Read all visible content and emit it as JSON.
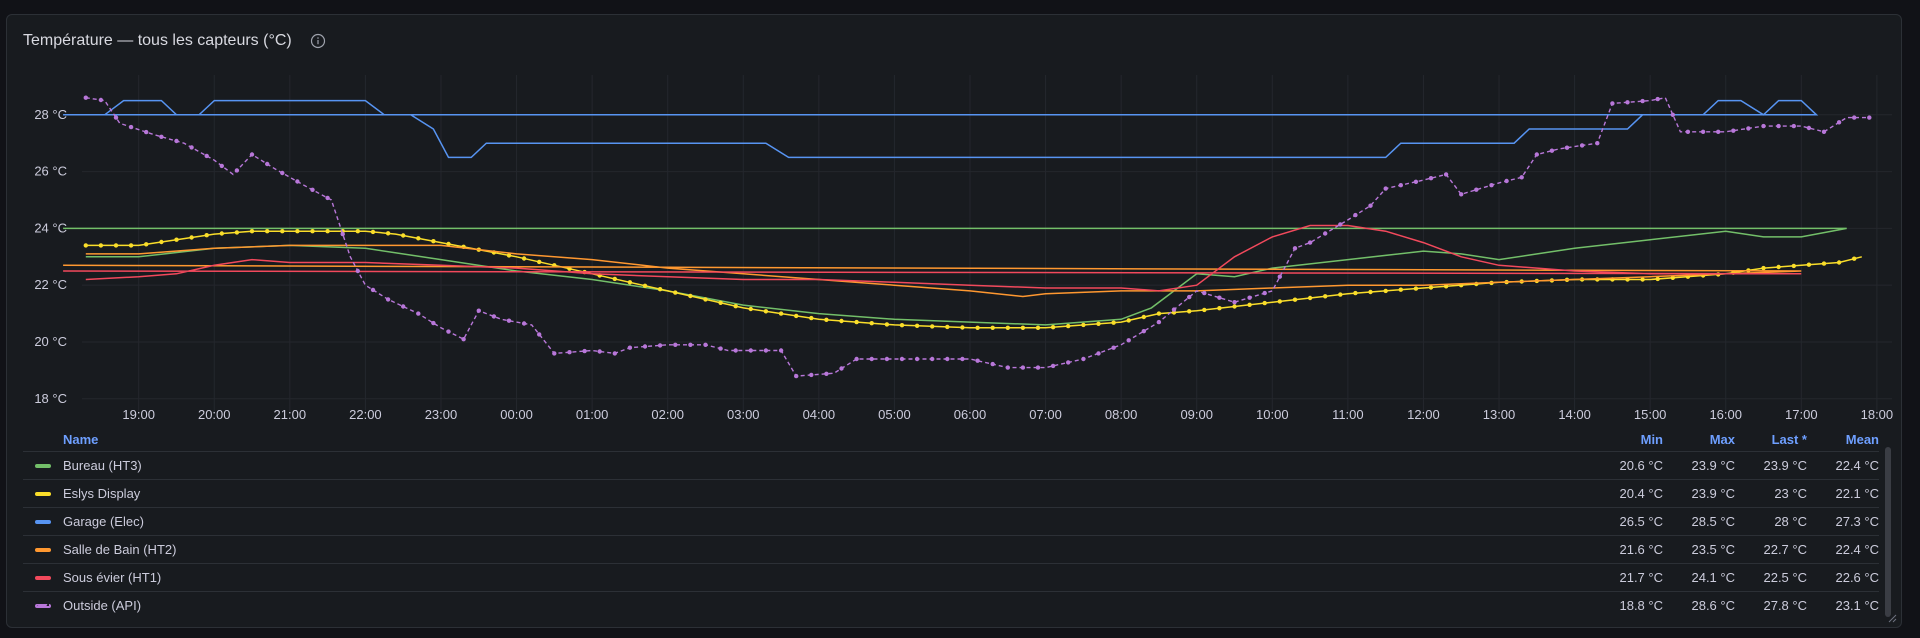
{
  "panel": {
    "title": "Température — tous les capteurs (°C)",
    "info_icon": "info-circle-icon"
  },
  "legend": {
    "headers": {
      "name": "Name",
      "min": "Min",
      "max": "Max",
      "last": "Last *",
      "mean": "Mean"
    },
    "rows": [
      {
        "name": "Bureau (HT3)",
        "min": "20.6 °C",
        "max": "23.9 °C",
        "last": "23.9 °C",
        "mean": "22.4 °C",
        "color": "#73bf69",
        "dashed": false
      },
      {
        "name": "Eslys Display",
        "min": "20.4 °C",
        "max": "23.9 °C",
        "last": "23 °C",
        "mean": "22.1 °C",
        "color": "#fade2a",
        "dashed": false
      },
      {
        "name": "Garage (Elec)",
        "min": "26.5 °C",
        "max": "28.5 °C",
        "last": "28 °C",
        "mean": "27.3 °C",
        "color": "#5794f2",
        "dashed": false
      },
      {
        "name": "Salle de Bain (HT2)",
        "min": "21.6 °C",
        "max": "23.5 °C",
        "last": "22.7 °C",
        "mean": "22.4 °C",
        "color": "#ff9830",
        "dashed": false
      },
      {
        "name": "Sous évier (HT1)",
        "min": "21.7 °C",
        "max": "24.1 °C",
        "last": "22.5 °C",
        "mean": "22.6 °C",
        "color": "#f2495c",
        "dashed": false
      },
      {
        "name": "Outside (API)",
        "min": "18.8 °C",
        "max": "28.6 °C",
        "last": "27.8 °C",
        "mean": "23.1 °C",
        "color": "#b877d9",
        "dashed": true
      }
    ]
  },
  "chart_data": {
    "type": "line",
    "xlabel": "",
    "ylabel": "",
    "x_unit": "hours (labels show HH:00)",
    "xlim": [
      18.25,
      42.2
    ],
    "ylim": [
      17.5,
      29.4
    ],
    "x_ticks": [
      "19:00",
      "20:00",
      "21:00",
      "22:00",
      "23:00",
      "00:00",
      "01:00",
      "02:00",
      "03:00",
      "04:00",
      "05:00",
      "06:00",
      "07:00",
      "08:00",
      "09:00",
      "10:00",
      "11:00",
      "12:00",
      "13:00",
      "14:00",
      "15:00",
      "16:00",
      "17:00",
      "18:00"
    ],
    "y_ticks": [
      "18 °C",
      "20 °C",
      "22 °C",
      "24 °C",
      "26 °C",
      "28 °C"
    ],
    "y_tick_values": [
      18,
      20,
      22,
      24,
      26,
      28
    ],
    "grid": true,
    "legend": "bottom",
    "series": [
      {
        "name": "Bureau (HT3)",
        "color": "#73bf69",
        "dashed": false,
        "points": [
          [
            18.3,
            23.0
          ],
          [
            19.0,
            23.0
          ],
          [
            20.0,
            23.3
          ],
          [
            21.0,
            23.4
          ],
          [
            22.0,
            23.3
          ],
          [
            23.0,
            22.9
          ],
          [
            0.0,
            22.5
          ],
          [
            1.0,
            22.2
          ],
          [
            2.0,
            21.8
          ],
          [
            3.0,
            21.3
          ],
          [
            4.0,
            21.0
          ],
          [
            5.0,
            20.8
          ],
          [
            6.0,
            20.7
          ],
          [
            7.0,
            20.6
          ],
          [
            8.0,
            20.8
          ],
          [
            8.4,
            21.2
          ],
          [
            9.0,
            22.4
          ],
          [
            9.5,
            22.3
          ],
          [
            10.0,
            22.6
          ],
          [
            11.0,
            22.9
          ],
          [
            12.0,
            23.2
          ],
          [
            12.5,
            23.1
          ],
          [
            13.0,
            22.9
          ],
          [
            14.0,
            23.3
          ],
          [
            15.0,
            23.6
          ],
          [
            16.0,
            23.9
          ],
          [
            16.5,
            23.7
          ],
          [
            17.0,
            23.7
          ],
          [
            17.6,
            24.0
          ],
          [
            18.0,
            24.0
          ]
        ]
      },
      {
        "name": "Eslys Display",
        "color": "#fade2a",
        "dashed": false,
        "points": [
          [
            18.3,
            23.4
          ],
          [
            19.0,
            23.4
          ],
          [
            20.0,
            23.8
          ],
          [
            20.5,
            23.9
          ],
          [
            21.0,
            23.9
          ],
          [
            22.0,
            23.9
          ],
          [
            22.4,
            23.8
          ],
          [
            23.0,
            23.5
          ],
          [
            0.0,
            23.0
          ],
          [
            1.0,
            22.4
          ],
          [
            2.0,
            21.8
          ],
          [
            3.0,
            21.2
          ],
          [
            4.0,
            20.8
          ],
          [
            5.0,
            20.6
          ],
          [
            6.0,
            20.5
          ],
          [
            7.0,
            20.5
          ],
          [
            8.0,
            20.7
          ],
          [
            8.5,
            21.0
          ],
          [
            9.0,
            21.1
          ],
          [
            10.0,
            21.4
          ],
          [
            11.0,
            21.7
          ],
          [
            12.0,
            21.9
          ],
          [
            13.0,
            22.1
          ],
          [
            14.0,
            22.2
          ],
          [
            15.0,
            22.2
          ],
          [
            16.0,
            22.4
          ],
          [
            16.5,
            22.6
          ],
          [
            17.0,
            22.7
          ],
          [
            17.5,
            22.8
          ],
          [
            17.8,
            23.0
          ]
        ]
      },
      {
        "name": "Garage (Elec)",
        "color": "#5794f2",
        "dashed": false,
        "points": [
          [
            18.3,
            28.0
          ],
          [
            18.55,
            28.0
          ],
          [
            18.8,
            28.5
          ],
          [
            19.3,
            28.5
          ],
          [
            19.5,
            28.0
          ],
          [
            19.8,
            28.0
          ],
          [
            20.0,
            28.5
          ],
          [
            22.0,
            28.5
          ],
          [
            22.25,
            28.0
          ],
          [
            22.6,
            28.0
          ],
          [
            22.9,
            27.5
          ],
          [
            23.1,
            26.5
          ],
          [
            23.4,
            26.5
          ],
          [
            23.6,
            27.0
          ],
          [
            3.3,
            27.0
          ],
          [
            3.6,
            26.5
          ],
          [
            11.5,
            26.5
          ],
          [
            11.7,
            27.0
          ],
          [
            13.2,
            27.0
          ],
          [
            13.4,
            27.5
          ],
          [
            14.7,
            27.5
          ],
          [
            14.9,
            28.0
          ],
          [
            15.7,
            28.0
          ],
          [
            15.9,
            28.5
          ],
          [
            16.2,
            28.5
          ],
          [
            16.5,
            28.0
          ],
          [
            16.7,
            28.5
          ],
          [
            17.0,
            28.5
          ],
          [
            17.2,
            28.0
          ],
          [
            18.0,
            28.0
          ]
        ]
      },
      {
        "name": "Salle de Bain (HT2)",
        "color": "#ff9830",
        "dashed": false,
        "points": [
          [
            18.3,
            23.1
          ],
          [
            19.0,
            23.1
          ],
          [
            20.0,
            23.3
          ],
          [
            21.0,
            23.4
          ],
          [
            22.0,
            23.4
          ],
          [
            23.0,
            23.4
          ],
          [
            0.0,
            23.1
          ],
          [
            1.0,
            22.9
          ],
          [
            2.0,
            22.6
          ],
          [
            3.0,
            22.4
          ],
          [
            4.0,
            22.2
          ],
          [
            5.0,
            22.0
          ],
          [
            6.0,
            21.8
          ],
          [
            6.7,
            21.6
          ],
          [
            7.0,
            21.7
          ],
          [
            8.0,
            21.8
          ],
          [
            9.0,
            21.8
          ],
          [
            10.0,
            21.9
          ],
          [
            11.0,
            22.0
          ],
          [
            12.0,
            22.0
          ],
          [
            13.0,
            22.1
          ],
          [
            14.0,
            22.2
          ],
          [
            15.0,
            22.3
          ],
          [
            16.0,
            22.4
          ],
          [
            17.0,
            22.5
          ],
          [
            18.0,
            22.7
          ]
        ]
      },
      {
        "name": "Sous évier (HT1)",
        "color": "#f2495c",
        "dashed": false,
        "points": [
          [
            18.3,
            22.2
          ],
          [
            19.0,
            22.3
          ],
          [
            19.5,
            22.4
          ],
          [
            20.0,
            22.7
          ],
          [
            20.5,
            22.9
          ],
          [
            21.0,
            22.8
          ],
          [
            22.0,
            22.8
          ],
          [
            23.0,
            22.7
          ],
          [
            0.0,
            22.6
          ],
          [
            1.0,
            22.4
          ],
          [
            2.0,
            22.3
          ],
          [
            3.0,
            22.2
          ],
          [
            4.0,
            22.2
          ],
          [
            5.0,
            22.1
          ],
          [
            6.0,
            22.0
          ],
          [
            7.0,
            21.9
          ],
          [
            8.0,
            21.9
          ],
          [
            8.5,
            21.8
          ],
          [
            9.0,
            22.0
          ],
          [
            9.5,
            23.0
          ],
          [
            10.0,
            23.7
          ],
          [
            10.5,
            24.1
          ],
          [
            11.0,
            24.1
          ],
          [
            11.5,
            23.9
          ],
          [
            12.0,
            23.5
          ],
          [
            12.5,
            23.0
          ],
          [
            13.0,
            22.7
          ],
          [
            14.0,
            22.5
          ],
          [
            15.0,
            22.4
          ],
          [
            16.0,
            22.4
          ],
          [
            17.0,
            22.4
          ],
          [
            18.0,
            22.5
          ]
        ]
      },
      {
        "name": "Outside (API)",
        "color": "#b877d9",
        "dashed": true,
        "points": [
          [
            18.3,
            28.6
          ],
          [
            18.55,
            28.5
          ],
          [
            18.75,
            27.7
          ],
          [
            19.2,
            27.3
          ],
          [
            19.6,
            27.0
          ],
          [
            20.0,
            26.4
          ],
          [
            20.25,
            25.9
          ],
          [
            20.5,
            26.6
          ],
          [
            20.8,
            26.1
          ],
          [
            21.2,
            25.5
          ],
          [
            21.55,
            25.0
          ],
          [
            21.8,
            23.0
          ],
          [
            22.0,
            22.0
          ],
          [
            22.3,
            21.5
          ],
          [
            22.7,
            21.0
          ],
          [
            23.0,
            20.5
          ],
          [
            23.3,
            20.1
          ],
          [
            23.5,
            21.1
          ],
          [
            23.8,
            20.8
          ],
          [
            0.2,
            20.6
          ],
          [
            0.5,
            19.6
          ],
          [
            1.0,
            19.7
          ],
          [
            1.3,
            19.6
          ],
          [
            1.5,
            19.8
          ],
          [
            2.0,
            19.9
          ],
          [
            2.5,
            19.9
          ],
          [
            2.8,
            19.7
          ],
          [
            3.5,
            19.7
          ],
          [
            3.7,
            18.8
          ],
          [
            4.2,
            18.9
          ],
          [
            4.5,
            19.4
          ],
          [
            5.0,
            19.4
          ],
          [
            6.0,
            19.4
          ],
          [
            6.5,
            19.1
          ],
          [
            7.0,
            19.1
          ],
          [
            7.5,
            19.4
          ],
          [
            8.0,
            19.9
          ],
          [
            8.5,
            20.7
          ],
          [
            9.0,
            21.8
          ],
          [
            9.5,
            21.4
          ],
          [
            10.0,
            21.8
          ],
          [
            10.3,
            23.3
          ],
          [
            10.5,
            23.5
          ],
          [
            11.0,
            24.3
          ],
          [
            11.3,
            24.8
          ],
          [
            11.5,
            25.4
          ],
          [
            12.0,
            25.7
          ],
          [
            12.3,
            25.9
          ],
          [
            12.5,
            25.2
          ],
          [
            13.0,
            25.6
          ],
          [
            13.3,
            25.8
          ],
          [
            13.5,
            26.6
          ],
          [
            13.8,
            26.8
          ],
          [
            14.3,
            27.0
          ],
          [
            14.5,
            28.4
          ],
          [
            15.0,
            28.5
          ],
          [
            15.2,
            28.6
          ],
          [
            15.4,
            27.4
          ],
          [
            16.0,
            27.4
          ],
          [
            16.5,
            27.6
          ],
          [
            17.0,
            27.6
          ],
          [
            17.3,
            27.4
          ],
          [
            17.6,
            27.9
          ],
          [
            17.9,
            27.9
          ]
        ]
      }
    ]
  }
}
